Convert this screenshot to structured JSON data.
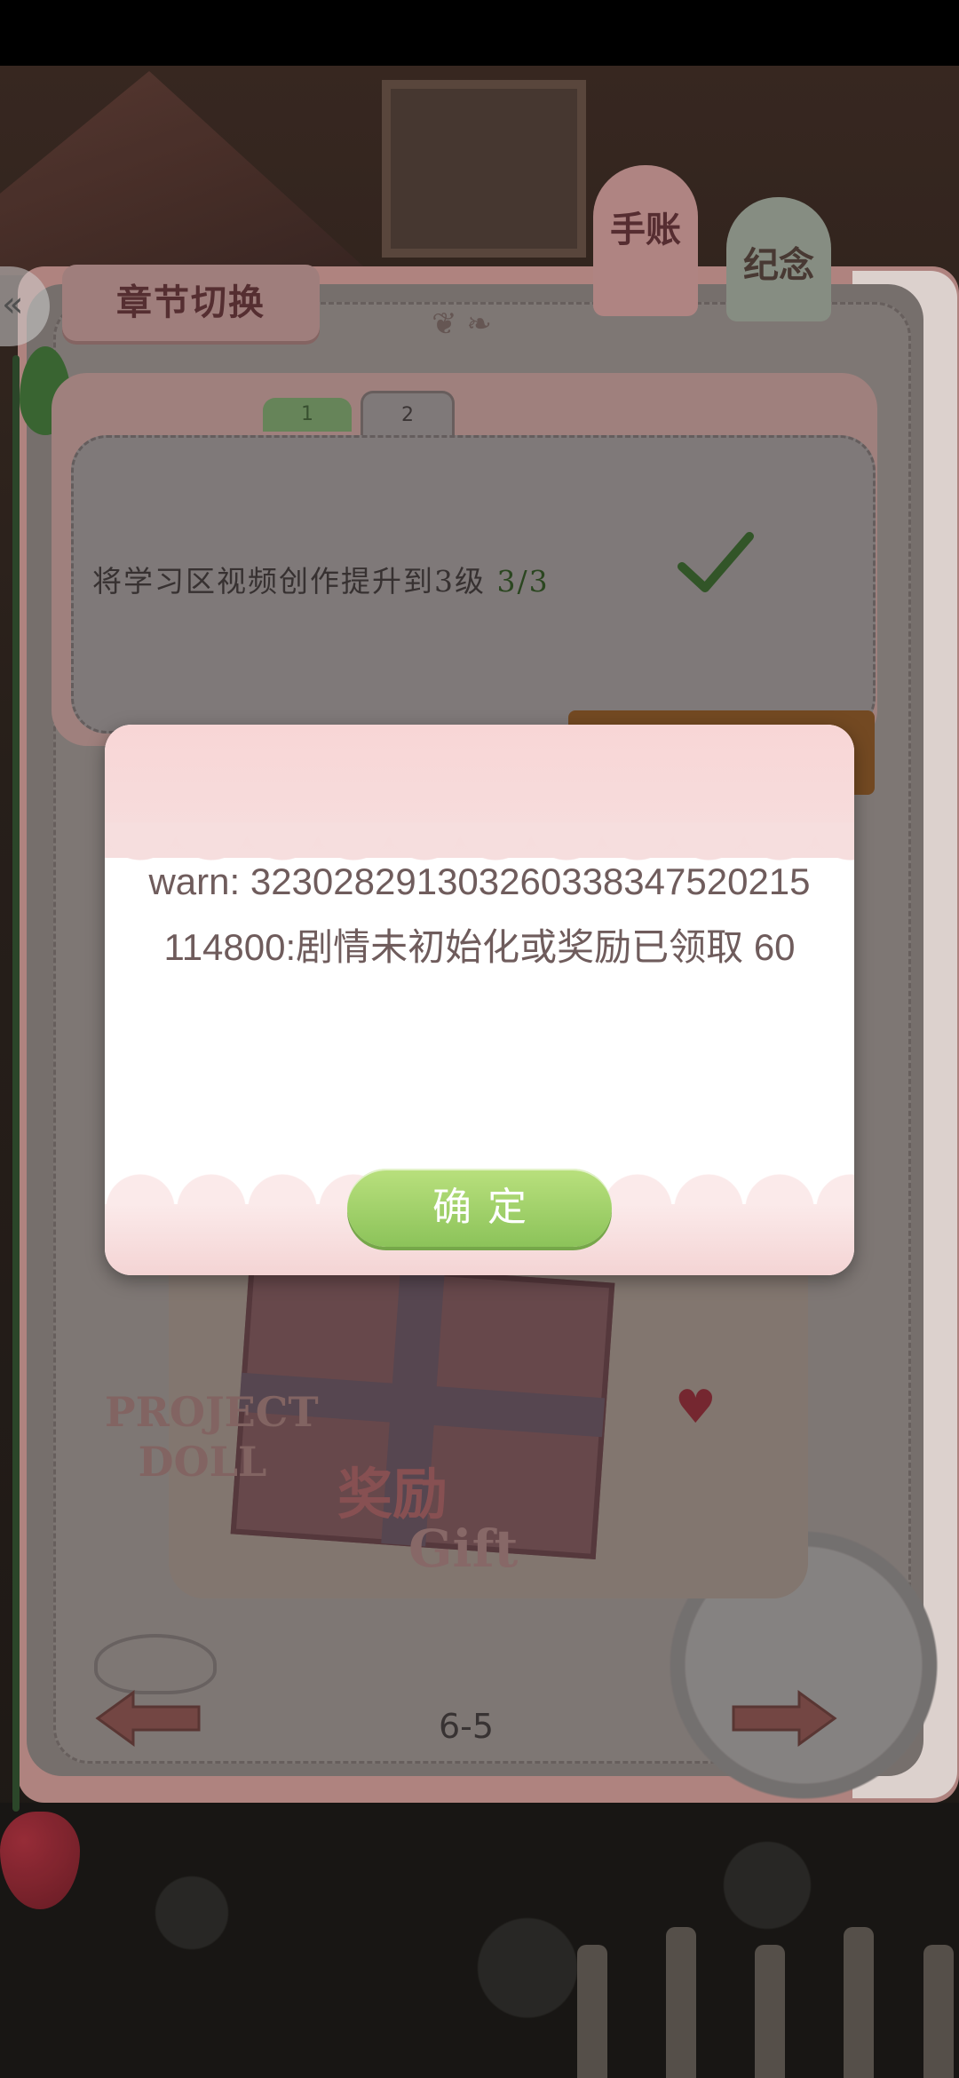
{
  "header": {
    "chapter_switch_label": "章节切换",
    "tabs": [
      {
        "label": "手账"
      },
      {
        "label": "纪念"
      }
    ]
  },
  "task_panel": {
    "page_tabs": [
      "1",
      "2"
    ],
    "task": {
      "text": "将学习区视频创作提升到3级",
      "progress": "3/3",
      "completed": true
    }
  },
  "reward": {
    "brand_line1": "PROJECT",
    "brand_line2": "DOLL",
    "title_cn": "奖励",
    "title_en": "Gift"
  },
  "pagination": {
    "page_label": "6-5"
  },
  "dialog": {
    "message": "warn: 323028291303260338347520215114800:剧情未初始化或奖励已领取 60",
    "confirm_label": "确定"
  },
  "colors": {
    "confirm_green": "#9ccf67",
    "dialog_pink": "#f6dede",
    "text_brown": "#6f5c5c"
  },
  "icons": {
    "chapter_toggle": "double-chevron-left-icon",
    "task_done": "check-icon",
    "prev": "arrow-left-icon",
    "next": "arrow-right-icon"
  }
}
